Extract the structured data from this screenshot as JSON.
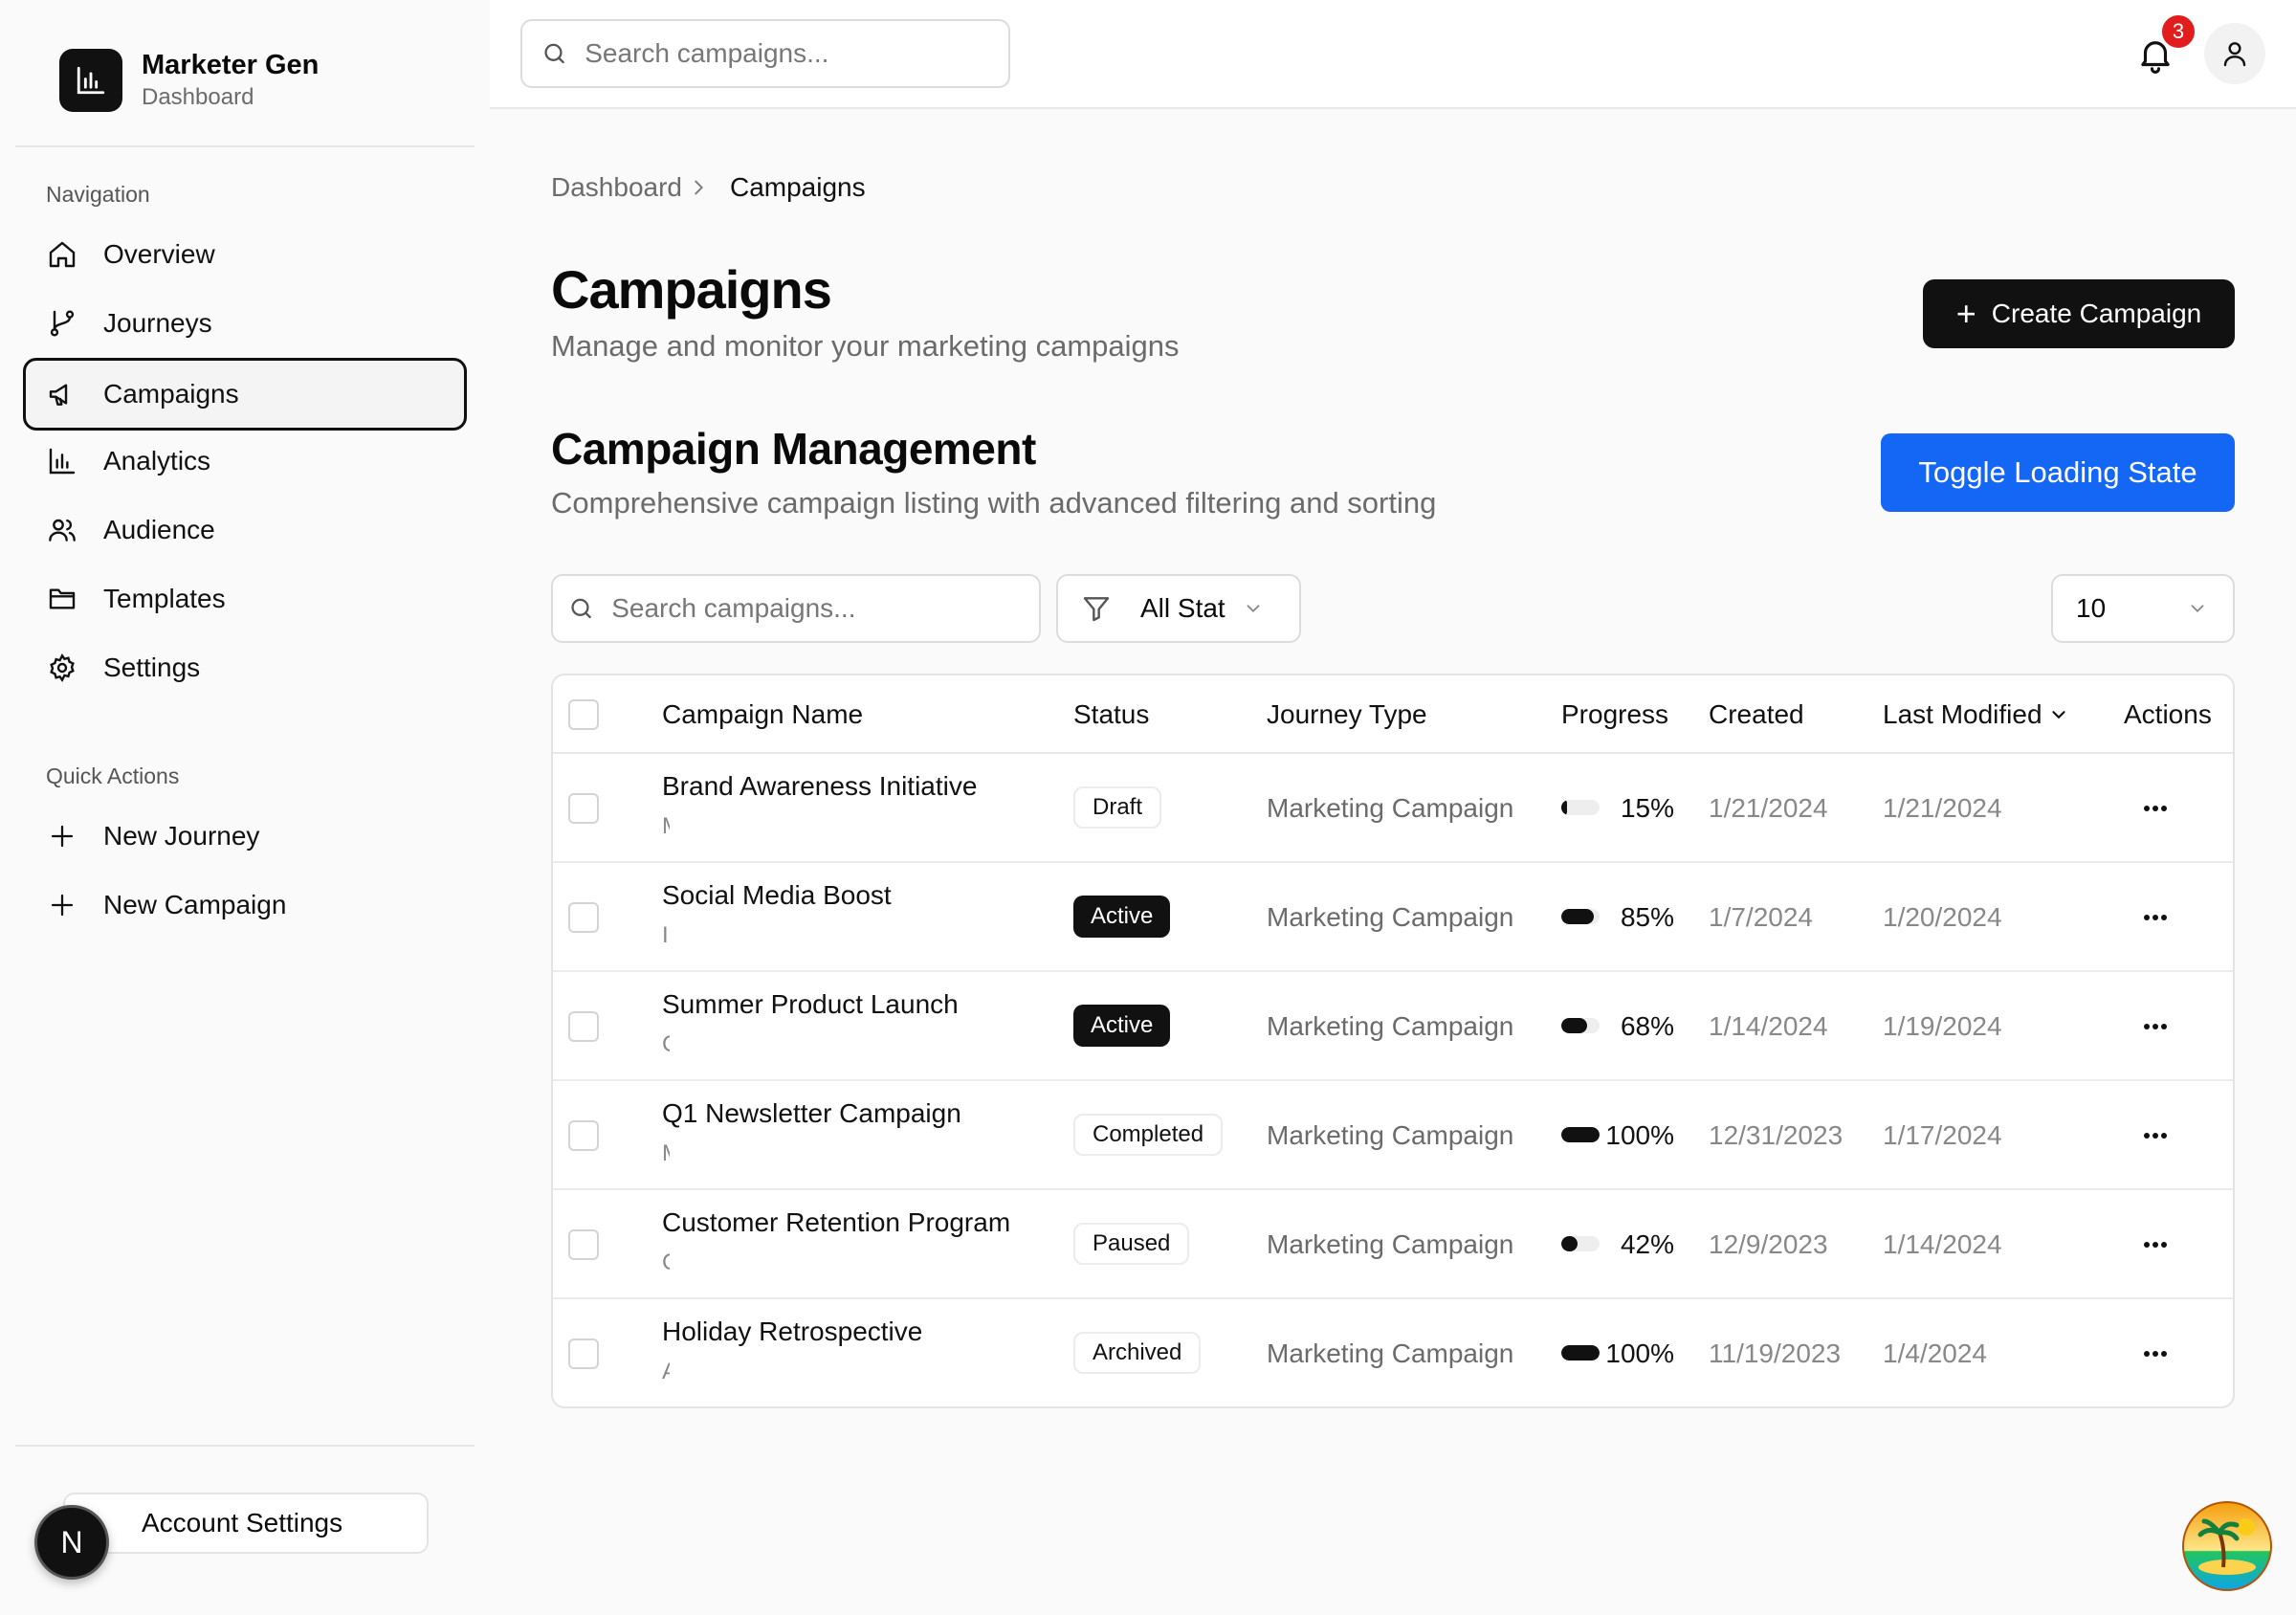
{
  "app": {
    "name": "Marketer Gen",
    "subtitle": "Dashboard"
  },
  "sidebar": {
    "nav_label": "Navigation",
    "items": [
      {
        "label": "Overview",
        "icon": "home-icon"
      },
      {
        "label": "Journeys",
        "icon": "git-branch-icon"
      },
      {
        "label": "Campaigns",
        "icon": "megaphone-icon",
        "active": true
      },
      {
        "label": "Analytics",
        "icon": "bar-chart-icon"
      },
      {
        "label": "Audience",
        "icon": "users-icon"
      },
      {
        "label": "Templates",
        "icon": "folder-icon"
      },
      {
        "label": "Settings",
        "icon": "gear-icon"
      }
    ],
    "quick_label": "Quick Actions",
    "quick": [
      {
        "label": "New Journey",
        "icon": "plus-icon"
      },
      {
        "label": "New Campaign",
        "icon": "plus-icon"
      }
    ],
    "account_label": "Account Settings",
    "n_badge": "N"
  },
  "topbar": {
    "search_placeholder": "Search campaigns...",
    "notifications_count": "3"
  },
  "breadcrumb": {
    "home": "Dashboard",
    "current": "Campaigns"
  },
  "page": {
    "title": "Campaigns",
    "subtitle": "Manage and monitor your marketing campaigns",
    "create_label": "Create Campaign"
  },
  "section": {
    "title": "Campaign Management",
    "subtitle": "Comprehensive campaign listing with advanced filtering and sorting",
    "toggle_label": "Toggle Loading State"
  },
  "filters": {
    "search_placeholder": "Search campaigns...",
    "status_value": "All Stat",
    "page_size": "10"
  },
  "table": {
    "headers": {
      "name": "Campaign Name",
      "status": "Status",
      "journey": "Journey Type",
      "progress": "Progress",
      "created": "Created",
      "modified": "Last Modified",
      "actions": "Actions"
    },
    "rows": [
      {
        "name": "Brand Awareness Initiative",
        "desc": "M",
        "status": "Draft",
        "status_style": "outline",
        "journey": "Marketing Campaign",
        "progress": 15,
        "progress_label": "15%",
        "created": "1/21/2024",
        "modified": "1/21/2024"
      },
      {
        "name": "Social Media Boost",
        "desc": "I",
        "status": "Active",
        "status_style": "dark",
        "journey": "Marketing Campaign",
        "progress": 85,
        "progress_label": "85%",
        "created": "1/7/2024",
        "modified": "1/20/2024"
      },
      {
        "name": "Summer Product Launch",
        "desc": "C",
        "status": "Active",
        "status_style": "dark",
        "journey": "Marketing Campaign",
        "progress": 68,
        "progress_label": "68%",
        "created": "1/14/2024",
        "modified": "1/19/2024"
      },
      {
        "name": "Q1 Newsletter Campaign",
        "desc": "M",
        "status": "Completed",
        "status_style": "outline",
        "journey": "Marketing Campaign",
        "progress": 100,
        "progress_label": "100%",
        "created": "12/31/2023",
        "modified": "1/17/2024"
      },
      {
        "name": "Customer Retention Program",
        "desc": "C",
        "status": "Paused",
        "status_style": "outline",
        "journey": "Marketing Campaign",
        "progress": 42,
        "progress_label": "42%",
        "created": "12/9/2023",
        "modified": "1/14/2024"
      },
      {
        "name": "Holiday Retrospective",
        "desc": "A",
        "status": "Archived",
        "status_style": "outline",
        "journey": "Marketing Campaign",
        "progress": 100,
        "progress_label": "100%",
        "created": "11/19/2023",
        "modified": "1/4/2024"
      }
    ]
  },
  "colors": {
    "accent": "#1466f5",
    "primary": "#111111",
    "notification": "#e11d1d"
  }
}
